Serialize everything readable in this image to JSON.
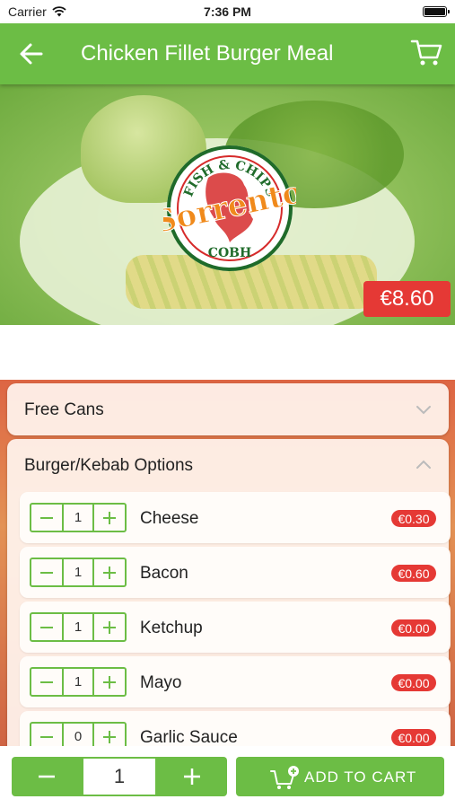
{
  "status_bar": {
    "carrier": "Carrier",
    "time": "7:36 PM"
  },
  "nav": {
    "title": "Chicken Fillet Burger Meal",
    "back_icon": "arrow-left-icon",
    "cart_icon": "cart-icon"
  },
  "hero": {
    "price": "€8.60",
    "logo": {
      "top_text": "FISH & CHIPS",
      "brand": "Sorrento",
      "bottom_text": "COBH"
    }
  },
  "sections": [
    {
      "title": "Free Cans",
      "expanded": false
    },
    {
      "title": "Burger/Kebab Options",
      "expanded": true
    }
  ],
  "options": [
    {
      "qty": "1",
      "name": "Cheese",
      "price": "€0.30"
    },
    {
      "qty": "1",
      "name": "Bacon",
      "price": "€0.60"
    },
    {
      "qty": "1",
      "name": "Ketchup",
      "price": "€0.00"
    },
    {
      "qty": "1",
      "name": "Mayo",
      "price": "€0.00"
    },
    {
      "qty": "0",
      "name": "Garlic Sauce",
      "price": "€0.00"
    }
  ],
  "bottom": {
    "quantity": "1",
    "add_to_cart_label": "ADD TO CART"
  },
  "colors": {
    "brand_green": "#6cbd45",
    "price_red": "#e53935",
    "logo_orange": "#f08a1c",
    "logo_red": "#d62b2b"
  }
}
